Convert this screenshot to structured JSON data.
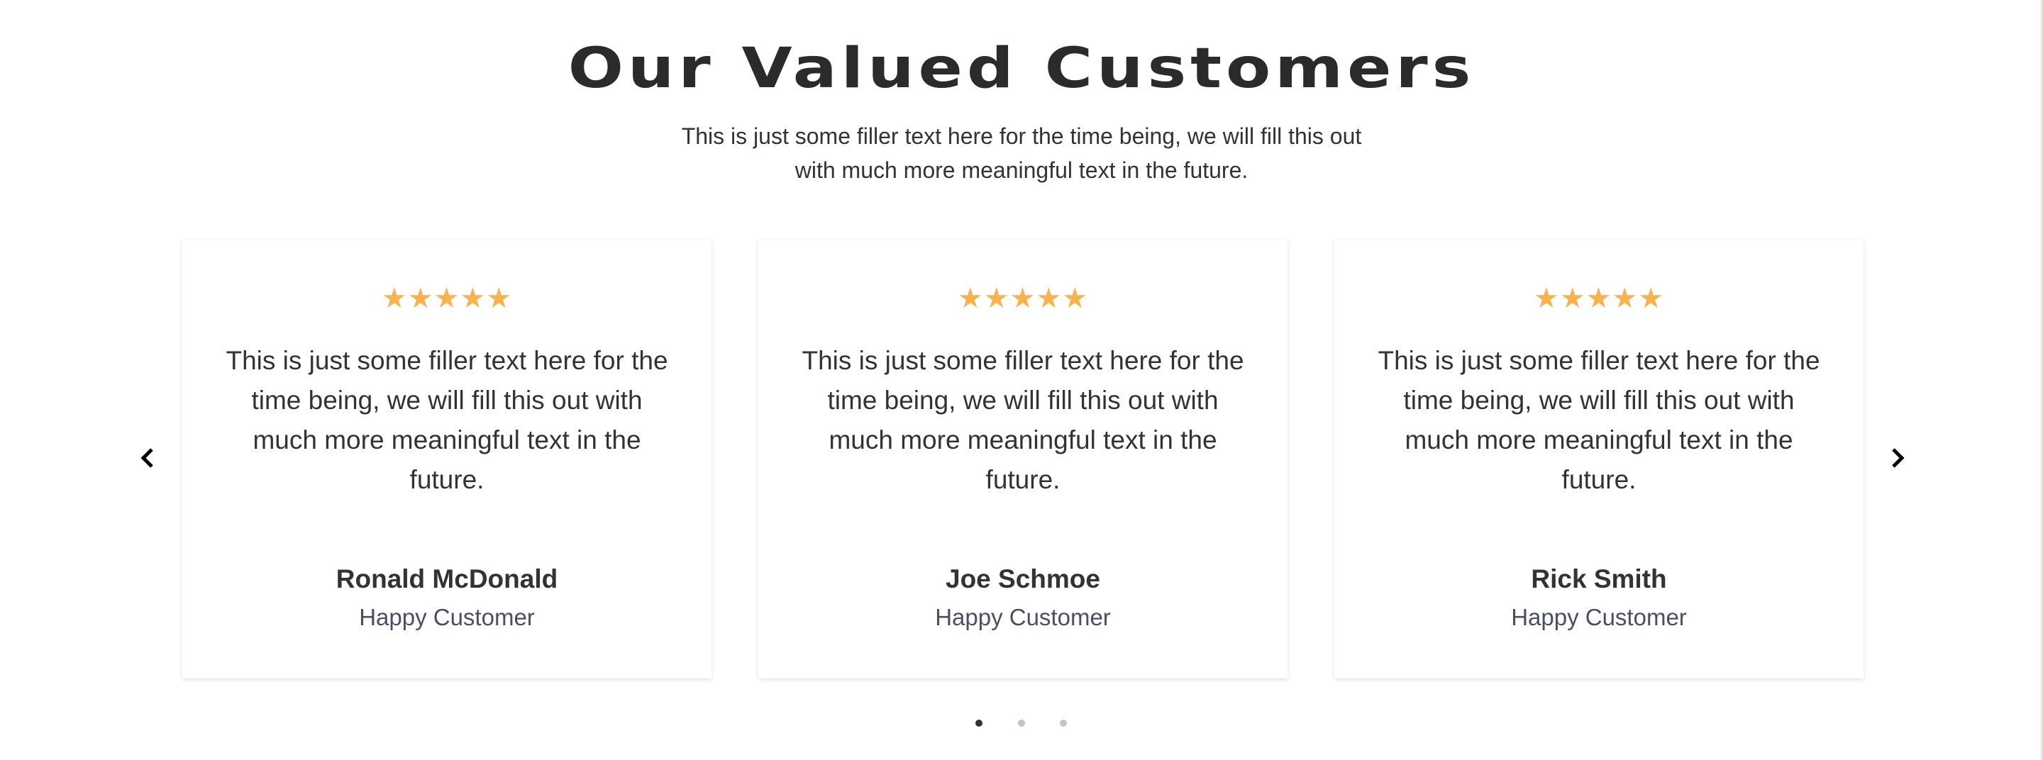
{
  "header": {
    "title": "Our Valued Customers",
    "subtitle": "This is just some filler text here for the time being, we will fill this out with much more meaningful text in the future."
  },
  "testimonials": [
    {
      "stars": "★★★★★",
      "rating": 5,
      "quote": "This is just some filler text here for the time being, we will fill this out with much more meaningful text in the future.",
      "name": "Ronald McDonald",
      "role": "Happy Customer"
    },
    {
      "stars": "★★★★★",
      "rating": 5,
      "quote": "This is just some filler text here for the time being, we will fill this out with much more meaningful text in the future.",
      "name": "Joe Schmoe",
      "role": "Happy Customer"
    },
    {
      "stars": "★★★★★",
      "rating": 5,
      "quote": "This is just some filler text here for the time being, we will fill this out with much more meaningful text in the future.",
      "name": "Rick Smith",
      "role": "Happy Customer"
    }
  ],
  "carousel": {
    "active_page": 1,
    "page_count": 3
  },
  "colors": {
    "star": "#f5b352",
    "text": "#333333",
    "role": "#4a5062"
  }
}
